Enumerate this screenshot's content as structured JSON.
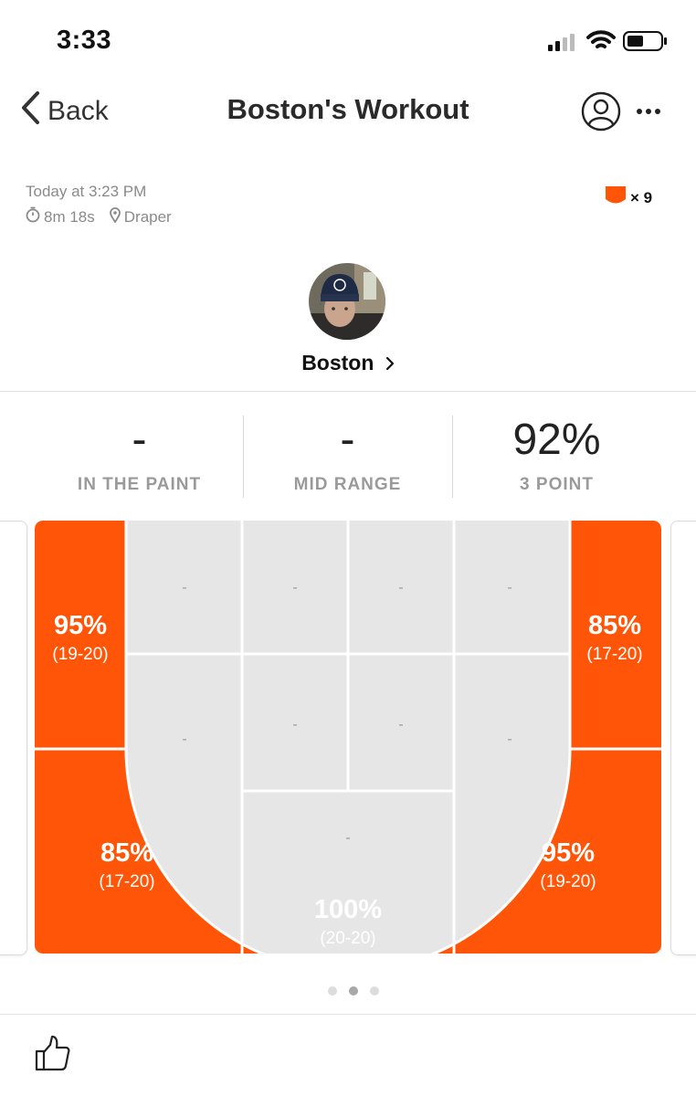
{
  "status_bar": {
    "time": "3:33"
  },
  "header": {
    "back_label": "Back",
    "title": "Boston's Workout"
  },
  "workout": {
    "date": "Today at 3:23 PM",
    "duration": "8m 18s",
    "location": "Draper",
    "badge_count": "× 9",
    "player_name": "Boston"
  },
  "stats": [
    {
      "value": "-",
      "label": "IN THE PAINT"
    },
    {
      "value": "-",
      "label": "MID RANGE"
    },
    {
      "value": "92%",
      "label": "3 POINT"
    }
  ],
  "court": {
    "accent_color": "#FF5508",
    "empty_color": "#E6E6E6",
    "zones": [
      {
        "id": "left-corner",
        "pct": "95%",
        "made": "(19-20)"
      },
      {
        "id": "right-corner",
        "pct": "85%",
        "made": "(17-20)"
      },
      {
        "id": "left-wing",
        "pct": "85%",
        "made": "(17-20)"
      },
      {
        "id": "right-wing",
        "pct": "95%",
        "made": "(19-20)"
      },
      {
        "id": "top-key",
        "pct": "100%",
        "made": "(20-20)"
      }
    ],
    "empty_label": "-"
  },
  "pager": {
    "pages": 3,
    "active": 1
  },
  "colors": {
    "accent": "#FF5508",
    "muted_text": "#8A8A8A"
  },
  "icons": [
    "signal-icon",
    "wifi-icon",
    "battery-icon",
    "chevron-left-icon",
    "profile-icon",
    "more-icon",
    "stopwatch-icon",
    "location-pin-icon",
    "shield-badge-icon",
    "chevron-right-icon",
    "thumbs-up-icon"
  ]
}
